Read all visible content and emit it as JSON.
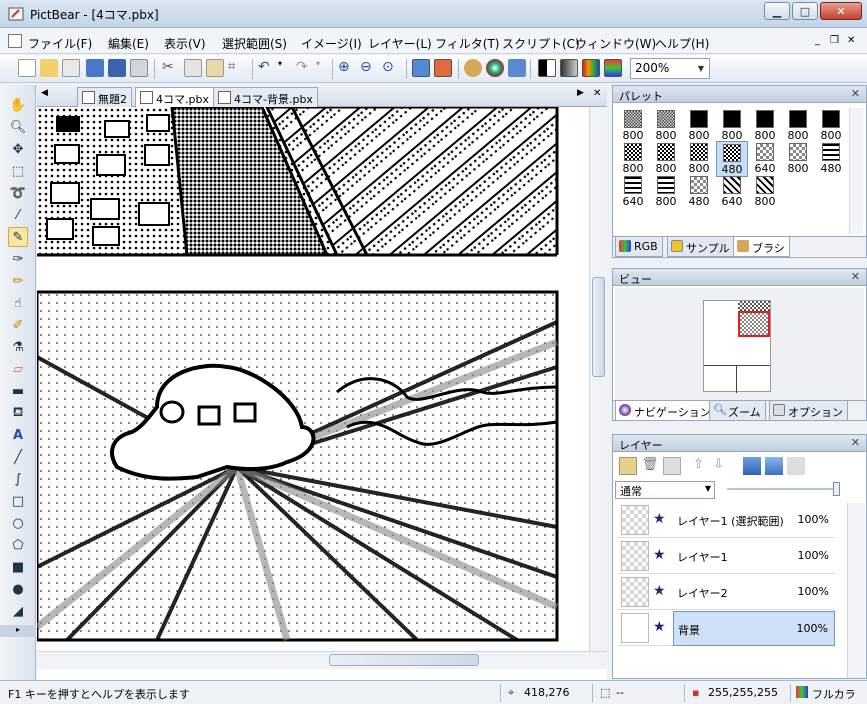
{
  "window": {
    "title": "PictBear - [4コマ.pbx]",
    "min": "▁",
    "max": "□",
    "close": "✕"
  },
  "menu": [
    "ファイル(F)",
    "編集(E)",
    "表示(V)",
    "選択範囲(S)",
    "イメージ(I)",
    "レイヤー(L)",
    "フィルタ(T)",
    "スクリプト(C)",
    "ウィンドウ(W)",
    "ヘルプ(H)"
  ],
  "toolbar": {
    "zoom": "200%"
  },
  "tabs": [
    "無題2",
    "4コマ.pbx",
    "4コマ-背景.pbx"
  ],
  "tab_nav": {
    "left": "◀",
    "right": "▶",
    "close": "✕"
  },
  "palette": {
    "title": "パレット",
    "values": [
      "800",
      "800",
      "800",
      "800",
      "800",
      "800",
      "800",
      "800",
      "800",
      "800",
      "480",
      "640",
      "800",
      "480",
      "640",
      "800",
      "480",
      "640",
      "800"
    ],
    "tabs": [
      "RGB",
      "サンプル",
      "ブラシ"
    ]
  },
  "view": {
    "title": "ビュー",
    "tabs": [
      "ナビゲーション",
      "ズーム",
      "オプション"
    ]
  },
  "layers": {
    "title": "レイヤー",
    "blend_mode": "通常",
    "rows": [
      {
        "name": "レイヤー1 (選択範囲)",
        "opacity": "100%"
      },
      {
        "name": "レイヤー1",
        "opacity": "100%"
      },
      {
        "name": "レイヤー2",
        "opacity": "100%"
      },
      {
        "name": "背景",
        "opacity": "100%"
      }
    ]
  },
  "status": {
    "help": "F1 キーを押すとヘルプを表示します",
    "coords": "418,276",
    "selection": "--",
    "color": "255,255,255",
    "mode": "フルカラ"
  },
  "colors": {
    "accent": "#6b97cf",
    "titlebar": "#c4d4e7",
    "close": "#c4412a"
  }
}
